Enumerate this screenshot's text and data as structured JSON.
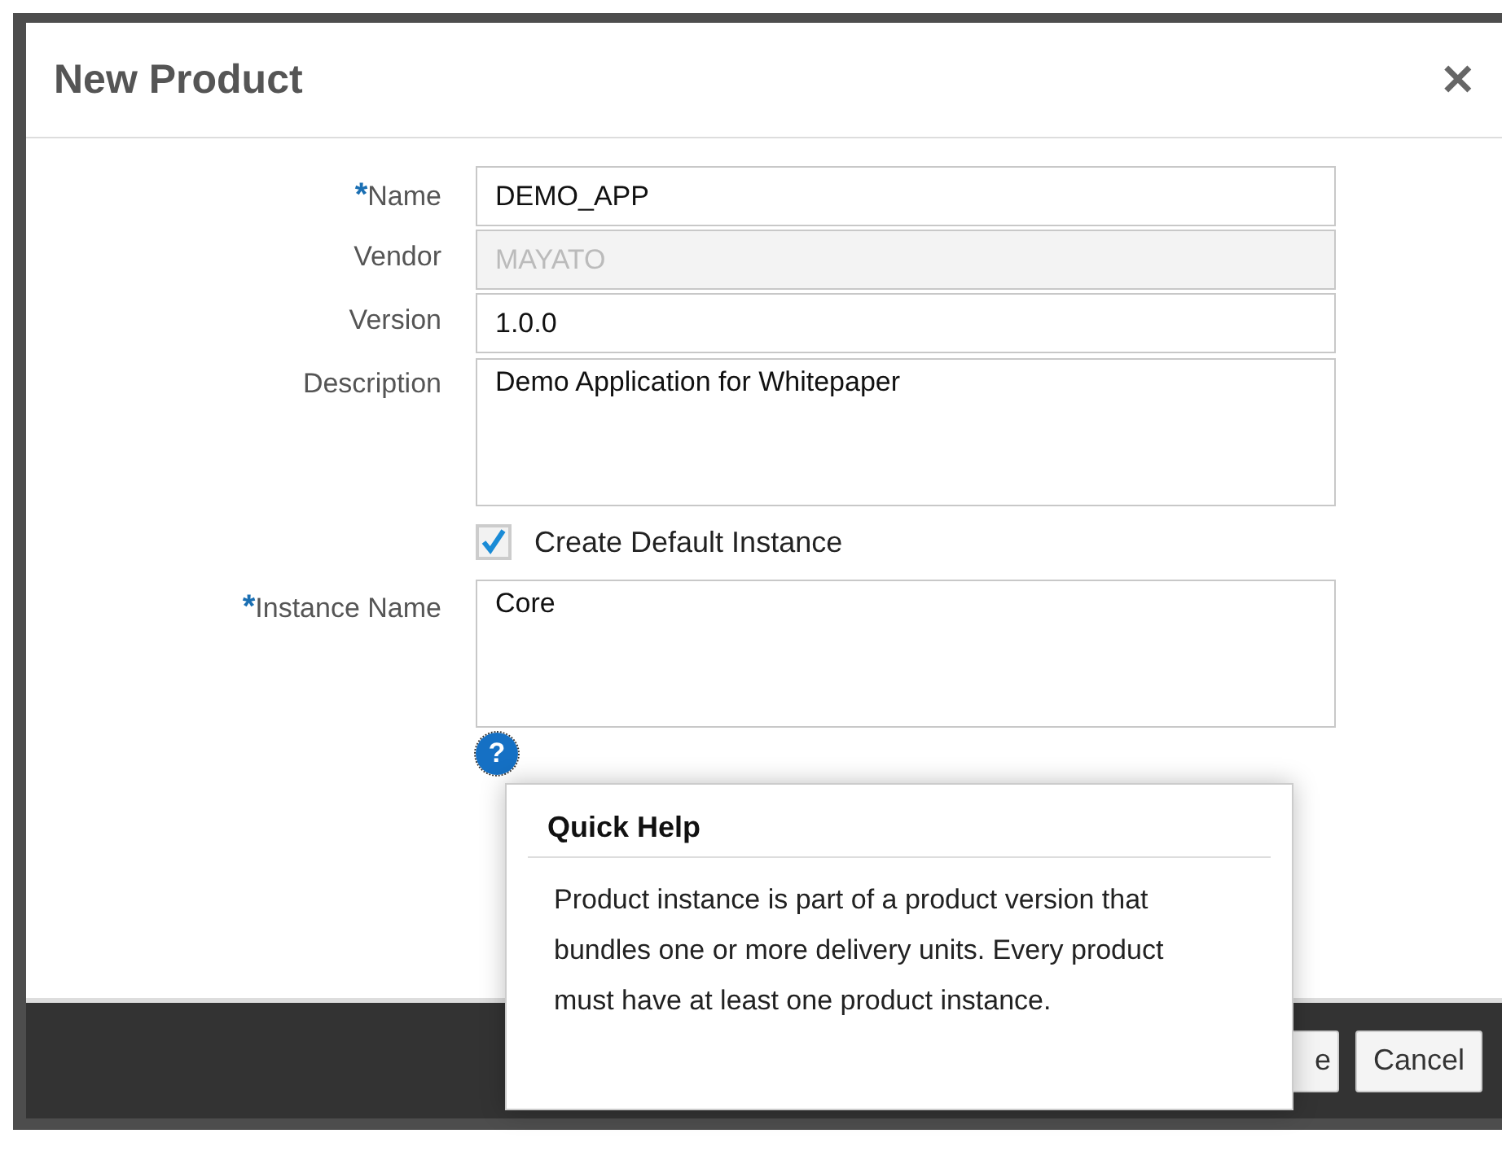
{
  "dialog": {
    "title": "New Product",
    "close": "✕"
  },
  "fields": [
    {
      "kind": "input",
      "label": "Name",
      "required": true,
      "value": "DEMO_APP",
      "disabled": false
    },
    {
      "kind": "input",
      "label": "Vendor",
      "required": false,
      "value": "MAYATO",
      "disabled": true
    },
    {
      "kind": "input",
      "label": "Version",
      "required": false,
      "value": "1.0.0",
      "disabled": false
    },
    {
      "kind": "textarea",
      "label": "Description",
      "required": false,
      "value": "Demo Application for Whitepaper",
      "disabled": false
    },
    {
      "kind": "checkbox",
      "label": "Create Default Instance",
      "checked": true
    },
    {
      "kind": "textarea",
      "label": "Instance Name",
      "required": true,
      "value": "Core",
      "disabled": false
    },
    {
      "kind": "help",
      "label": "?"
    }
  ],
  "required_mark": "*",
  "quick_help": {
    "title": "Quick Help",
    "text": "Product instance is part of a product version that bundles one or more delivery units. Every product must have at least one product instance."
  },
  "buttons": [
    {
      "label": "e"
    },
    {
      "label": "Cancel"
    }
  ]
}
